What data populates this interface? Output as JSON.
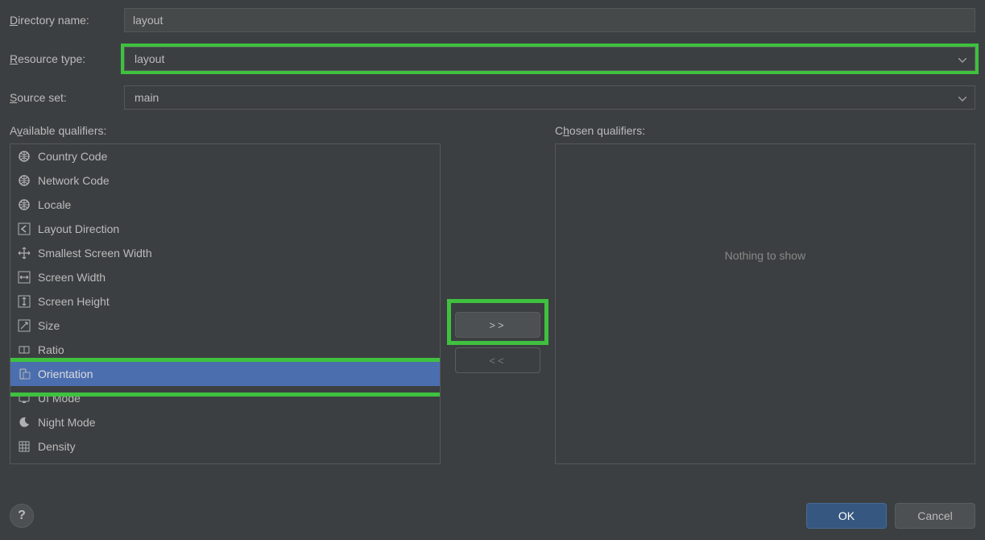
{
  "labels": {
    "directory_name": "Directory name:",
    "resource_type": "Resource type:",
    "source_set": "Source set:",
    "available": "Available qualifiers:",
    "chosen": "Chosen qualifiers:"
  },
  "fields": {
    "directory_name": "layout",
    "resource_type": "layout",
    "source_set": "main"
  },
  "qualifiers": [
    {
      "icon": "globe-flag",
      "label": "Country Code"
    },
    {
      "icon": "globe-net",
      "label": "Network Code"
    },
    {
      "icon": "globe",
      "label": "Locale"
    },
    {
      "icon": "arrow-left",
      "label": "Layout Direction"
    },
    {
      "icon": "arrows-all",
      "label": "Smallest Screen Width"
    },
    {
      "icon": "arrows-h",
      "label": "Screen Width"
    },
    {
      "icon": "arrows-v",
      "label": "Screen Height"
    },
    {
      "icon": "resize",
      "label": "Size"
    },
    {
      "icon": "ratio",
      "label": "Ratio"
    },
    {
      "icon": "orientation",
      "label": "Orientation",
      "selected": true
    },
    {
      "icon": "ui-mode",
      "label": "UI Mode"
    },
    {
      "icon": "night",
      "label": "Night Mode"
    },
    {
      "icon": "density",
      "label": "Density"
    }
  ],
  "chosen_empty": "Nothing to show",
  "buttons": {
    "add": ">>",
    "remove": "<<",
    "ok": "OK",
    "cancel": "Cancel",
    "help": "?"
  },
  "highlights": {
    "resource_type": true,
    "add_button": true,
    "orientation_row": true
  }
}
